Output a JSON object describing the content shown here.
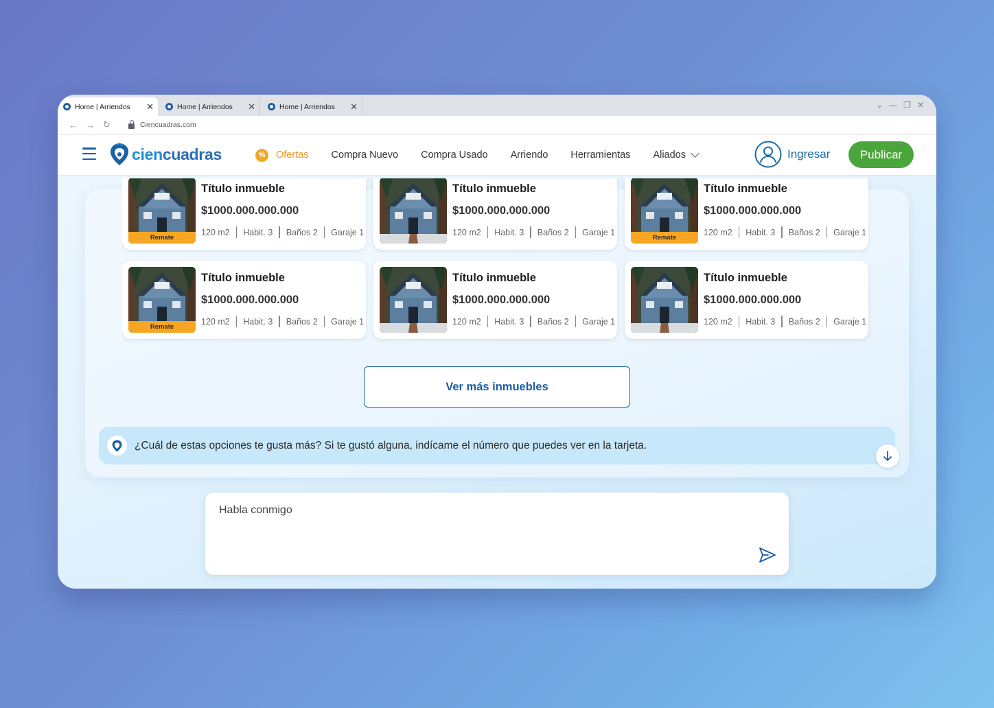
{
  "browser": {
    "tabs": [
      {
        "label": "Home | Arriendos",
        "active": true
      },
      {
        "label": "Home | Arriendos",
        "active": false
      },
      {
        "label": "Home | Arriendos",
        "active": false
      }
    ],
    "url": "Ciencuadras.com"
  },
  "header": {
    "logo_text_1": "cien",
    "logo_text_2": "cuadras",
    "nav": {
      "offers": "Ofertas",
      "new": "Compra Nuevo",
      "used": "Compra Usado",
      "rent": "Arriendo",
      "tools": "Herramientas",
      "allies": "Aliados"
    },
    "login": "Ingresar",
    "publish": "Publicar"
  },
  "cards": [
    {
      "title": "Título inmueble",
      "price": "$1000.000.000.000",
      "area": "120 m2",
      "rooms": "Habit. 3",
      "baths": "Baños 2",
      "garage": "Garaje 1",
      "badge": "Remate"
    },
    {
      "title": "Título inmueble",
      "price": "$1000.000.000.000",
      "area": "120 m2",
      "rooms": "Habit. 3",
      "baths": "Baños 2",
      "garage": "Garaje 1",
      "badge": ""
    },
    {
      "title": "Título inmueble",
      "price": "$1000.000.000.000",
      "area": "120 m2",
      "rooms": "Habit. 3",
      "baths": "Baños 2",
      "garage": "Garaje 1",
      "badge": "Remate"
    },
    {
      "title": "Título inmueble",
      "price": "$1000.000.000.000",
      "area": "120 m2",
      "rooms": "Habit. 3",
      "baths": "Baños 2",
      "garage": "Garaje 1",
      "badge": "Remate"
    },
    {
      "title": "Título inmueble",
      "price": "$1000.000.000.000",
      "area": "120 m2",
      "rooms": "Habit. 3",
      "baths": "Baños 2",
      "garage": "Garaje 1",
      "badge": ""
    },
    {
      "title": "Título inmueble",
      "price": "$1000.000.000.000",
      "area": "120 m2",
      "rooms": "Habit. 3",
      "baths": "Baños 2",
      "garage": "Garaje 1",
      "badge": ""
    }
  ],
  "chat": {
    "more_button": "Ver más inmuebles",
    "bot_message": "¿Cuál de estas opciones te gusta más? Si te gustó alguna, indícame el número que puedes ver en la tarjeta.",
    "input_placeholder": "Habla conmigo"
  },
  "colors": {
    "brand_blue": "#1b5fa5",
    "offer_orange": "#f0941a",
    "publish_green": "#4aa63a",
    "badge_orange": "#f6a623"
  }
}
